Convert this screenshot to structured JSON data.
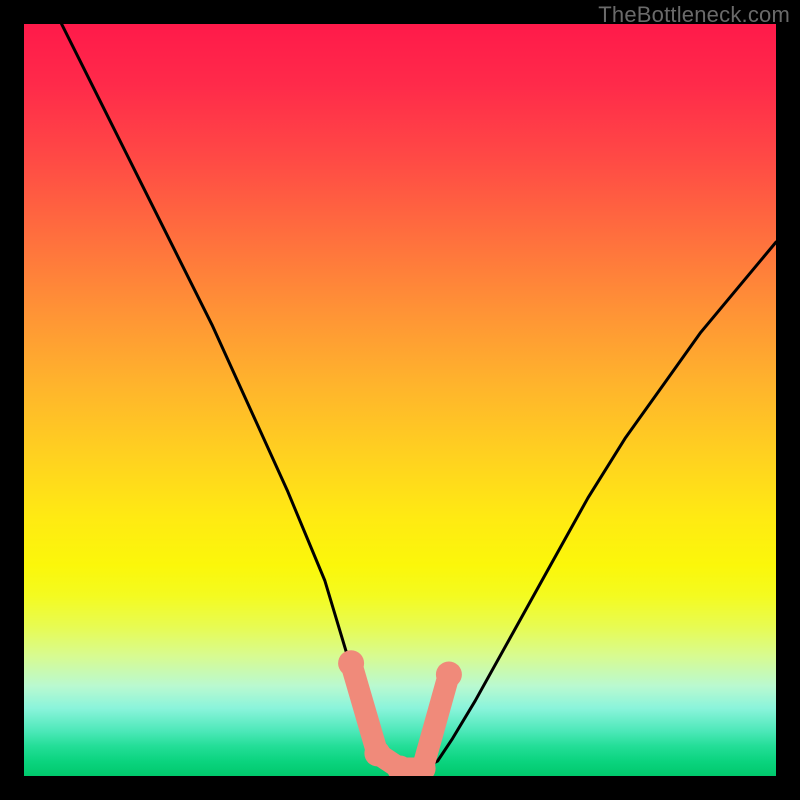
{
  "watermark": "TheBottleneck.com",
  "chart_data": {
    "type": "line",
    "title": "",
    "xlabel": "",
    "ylabel": "",
    "x_range": [
      0,
      100
    ],
    "y_range": [
      0,
      100
    ],
    "series": [
      {
        "name": "bottleneck-curve",
        "x": [
          5,
          10,
          15,
          20,
          25,
          30,
          35,
          40,
          43,
          45,
          47,
          49,
          51,
          53,
          55,
          57,
          60,
          65,
          70,
          75,
          80,
          85,
          90,
          95,
          100
        ],
        "y": [
          100,
          90,
          80,
          70,
          60,
          49,
          38,
          26,
          16,
          10,
          5,
          2,
          1,
          1,
          2,
          5,
          10,
          19,
          28,
          37,
          45,
          52,
          59,
          65,
          71
        ]
      }
    ],
    "markers": {
      "name": "highlight-nodes",
      "color": "#f08a7a",
      "x": [
        43.5,
        47.0,
        50.0,
        53.0,
        56.5
      ],
      "y": [
        15.0,
        3.0,
        1.0,
        1.0,
        13.5
      ]
    },
    "background": {
      "type": "vertical-gradient",
      "stops": [
        {
          "pos": 0.0,
          "color": "#ff1a4a"
        },
        {
          "pos": 0.5,
          "color": "#ffd31f"
        },
        {
          "pos": 0.8,
          "color": "#e8fb50"
        },
        {
          "pos": 1.0,
          "color": "#00c86c"
        }
      ]
    }
  }
}
